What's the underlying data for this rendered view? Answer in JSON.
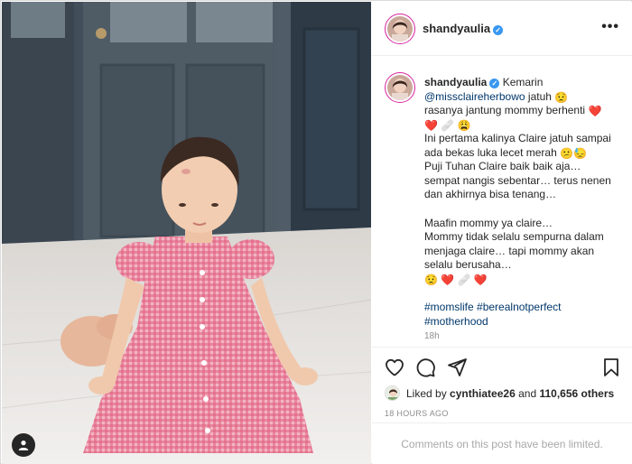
{
  "post": {
    "username": "shandyaulia",
    "verified": true,
    "more_label": "•••"
  },
  "caption": {
    "username": "shandyaulia",
    "lines": [
      "Kemarin",
      "@missclaireherbowo",
      "jatuh",
      "rasanya jantung mommy berhenti",
      "Ini pertama kalinya Claire jatuh sampai",
      "ada bekas luka lecet merah",
      "Puji Tuhan Claire baik baik aja…",
      "sempat nangis sebentar… terus nenen",
      "dan akhirnya bisa tenang…",
      "Maafin mommy ya claire…",
      "Mommy tidak selalu sempurna dalam",
      "menjaga claire… tapi mommy akan",
      "selalu berusaha…"
    ],
    "emojis": {
      "worried": "😟",
      "heart": "❤️",
      "bandage": "🩹",
      "tired": "😩",
      "sad": "😕",
      "sweat": "😓"
    },
    "hashtags": [
      "#momslife",
      "#berealnotperfect",
      "#motherhood"
    ],
    "time_ago": "18h"
  },
  "engagement": {
    "liked_by_prefix": "Liked by",
    "liked_by_user": "cynthiatee26",
    "liked_by_and": "and",
    "likes_count": "110,656 others",
    "date": "18 HOURS AGO",
    "comments_disabled": "Comments on this post have been limited."
  },
  "icons": {
    "like": "heart-outline-icon",
    "comment": "comment-icon",
    "share": "paper-plane-icon",
    "save": "bookmark-icon",
    "more": "more-horizontal-icon",
    "user_tags": "user-tag-icon",
    "verified": "verified-badge-icon"
  },
  "colors": {
    "link": "#00376b",
    "verified": "#3897f0",
    "muted": "#8e8e8e",
    "border": "#dbdbdb"
  }
}
